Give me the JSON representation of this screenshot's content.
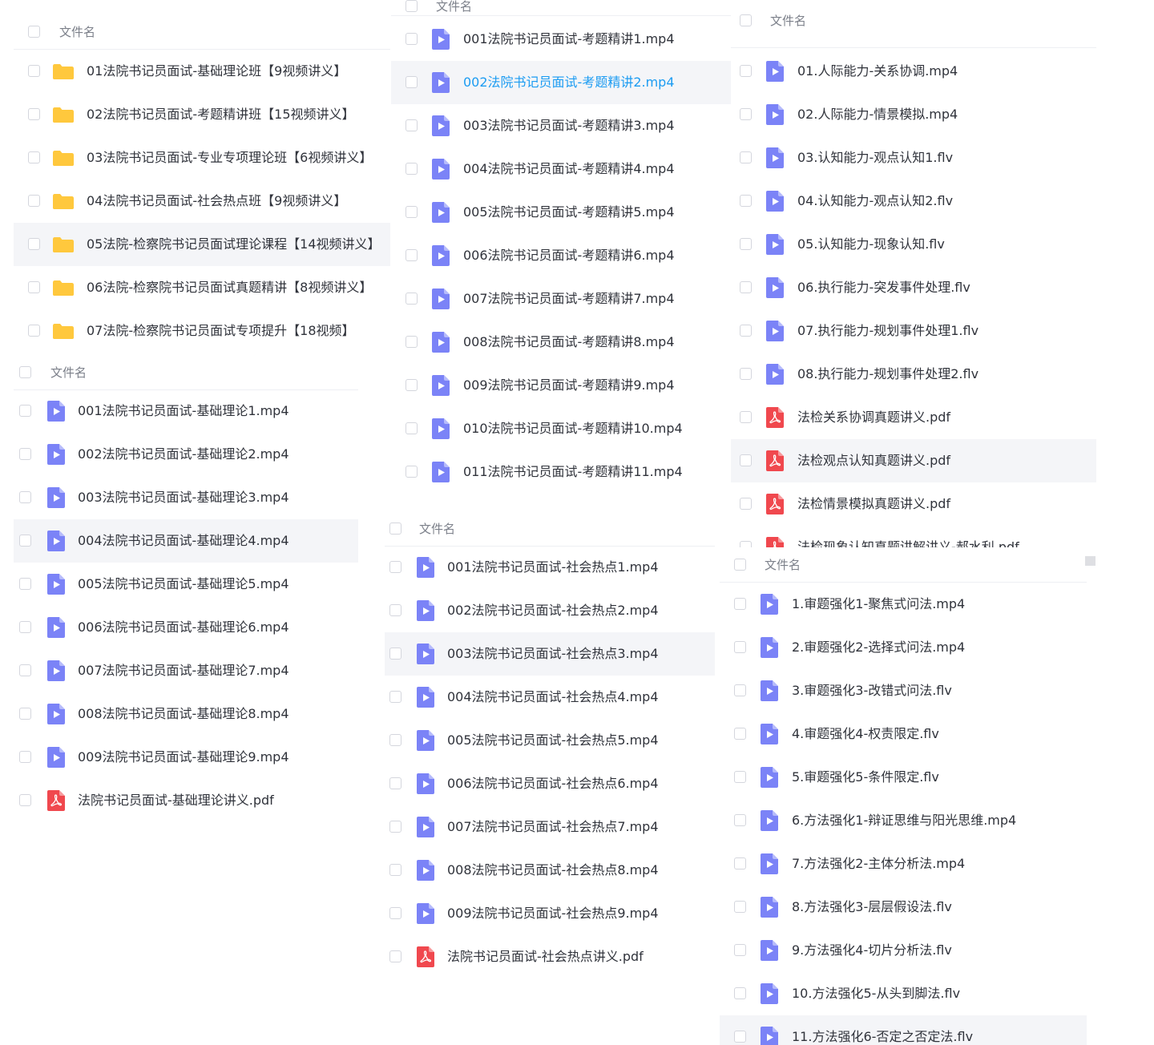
{
  "panels": {
    "a": {
      "header": "文件名",
      "items": [
        {
          "type": "folder",
          "label": "01法院书记员面试-基础理论班【9视频讲义】"
        },
        {
          "type": "folder",
          "label": "02法院书记员面试-考题精讲班【15视频讲义】"
        },
        {
          "type": "folder",
          "label": "03法院书记员面试-专业专项理论班【6视频讲义】"
        },
        {
          "type": "folder",
          "label": "04法院书记员面试-社会热点班【9视频讲义】"
        },
        {
          "type": "folder",
          "label": "05法院-检察院书记员面试理论课程【14视频讲义】",
          "highlight": true
        },
        {
          "type": "folder",
          "label": "06法院-检察院书记员面试真题精讲【8视频讲义】"
        },
        {
          "type": "folder",
          "label": "07法院-检察院书记员面试专项提升【18视频】"
        }
      ]
    },
    "b": {
      "header": "文件名",
      "items": [
        {
          "type": "video",
          "label": "001法院书记员面试-基础理论1.mp4"
        },
        {
          "type": "video",
          "label": "002法院书记员面试-基础理论2.mp4"
        },
        {
          "type": "video",
          "label": "003法院书记员面试-基础理论3.mp4"
        },
        {
          "type": "video",
          "label": "004法院书记员面试-基础理论4.mp4",
          "highlight": true
        },
        {
          "type": "video",
          "label": "005法院书记员面试-基础理论5.mp4"
        },
        {
          "type": "video",
          "label": "006法院书记员面试-基础理论6.mp4"
        },
        {
          "type": "video",
          "label": "007法院书记员面试-基础理论7.mp4"
        },
        {
          "type": "video",
          "label": "008法院书记员面试-基础理论8.mp4"
        },
        {
          "type": "video",
          "label": "009法院书记员面试-基础理论9.mp4"
        },
        {
          "type": "pdf",
          "label": "法院书记员面试-基础理论讲义.pdf"
        }
      ]
    },
    "c": {
      "header": "文件名",
      "items": [
        {
          "type": "video",
          "label": "001法院书记员面试-考题精讲1.mp4"
        },
        {
          "type": "video",
          "label": "002法院书记员面试-考题精讲2.mp4",
          "highlight": true,
          "active": true
        },
        {
          "type": "video",
          "label": "003法院书记员面试-考题精讲3.mp4"
        },
        {
          "type": "video",
          "label": "004法院书记员面试-考题精讲4.mp4"
        },
        {
          "type": "video",
          "label": "005法院书记员面试-考题精讲5.mp4"
        },
        {
          "type": "video",
          "label": "006法院书记员面试-考题精讲6.mp4"
        },
        {
          "type": "video",
          "label": "007法院书记员面试-考题精讲7.mp4"
        },
        {
          "type": "video",
          "label": "008法院书记员面试-考题精讲8.mp4"
        },
        {
          "type": "video",
          "label": "009法院书记员面试-考题精讲9.mp4"
        },
        {
          "type": "video",
          "label": "010法院书记员面试-考题精讲10.mp4"
        },
        {
          "type": "video",
          "label": "011法院书记员面试-考题精讲11.mp4"
        }
      ]
    },
    "d": {
      "header": "文件名",
      "items": [
        {
          "type": "video",
          "label": "001法院书记员面试-社会热点1.mp4"
        },
        {
          "type": "video",
          "label": "002法院书记员面试-社会热点2.mp4"
        },
        {
          "type": "video",
          "label": "003法院书记员面试-社会热点3.mp4",
          "highlight": true
        },
        {
          "type": "video",
          "label": "004法院书记员面试-社会热点4.mp4"
        },
        {
          "type": "video",
          "label": "005法院书记员面试-社会热点5.mp4"
        },
        {
          "type": "video",
          "label": "006法院书记员面试-社会热点6.mp4"
        },
        {
          "type": "video",
          "label": "007法院书记员面试-社会热点7.mp4"
        },
        {
          "type": "video",
          "label": "008法院书记员面试-社会热点8.mp4"
        },
        {
          "type": "video",
          "label": "009法院书记员面试-社会热点9.mp4"
        },
        {
          "type": "pdf",
          "label": "法院书记员面试-社会热点讲义.pdf"
        }
      ]
    },
    "e": {
      "header": "文件名",
      "items": [
        {
          "type": "video",
          "label": "01.人际能力-关系协调.mp4"
        },
        {
          "type": "video",
          "label": "02.人际能力-情景模拟.mp4"
        },
        {
          "type": "video",
          "label": "03.认知能力-观点认知1.flv"
        },
        {
          "type": "video",
          "label": "04.认知能力-观点认知2.flv"
        },
        {
          "type": "video",
          "label": "05.认知能力-现象认知.flv"
        },
        {
          "type": "video",
          "label": "06.执行能力-突发事件处理.flv"
        },
        {
          "type": "video",
          "label": "07.执行能力-规划事件处理1.flv"
        },
        {
          "type": "video",
          "label": "08.执行能力-规划事件处理2.flv"
        },
        {
          "type": "pdf",
          "label": "法检关系协调真题讲义.pdf"
        },
        {
          "type": "pdf",
          "label": "法检观点认知真题讲义.pdf",
          "highlight": true
        },
        {
          "type": "pdf",
          "label": "法检情景模拟真题讲义.pdf"
        },
        {
          "type": "pdf",
          "label": "法检现象认知真题讲解讲义-郝水利.pdf"
        }
      ]
    },
    "f": {
      "header": "文件名",
      "items": [
        {
          "type": "video",
          "label": "1.审题强化1-聚焦式问法.mp4"
        },
        {
          "type": "video",
          "label": "2.审题强化2-选择式问法.mp4"
        },
        {
          "type": "video",
          "label": "3.审题强化3-改错式问法.flv"
        },
        {
          "type": "video",
          "label": "4.审题强化4-权责限定.flv"
        },
        {
          "type": "video",
          "label": "5.审题强化5-条件限定.flv"
        },
        {
          "type": "video",
          "label": "6.方法强化1-辩证思维与阳光思维.mp4"
        },
        {
          "type": "video",
          "label": "7.方法强化2-主体分析法.mp4"
        },
        {
          "type": "video",
          "label": "8.方法强化3-层层假设法.flv"
        },
        {
          "type": "video",
          "label": "9.方法强化4-切片分析法.flv"
        },
        {
          "type": "video",
          "label": "10.方法强化5-从头到脚法.flv"
        },
        {
          "type": "video",
          "label": "11.方法强化6-否定之否定法.flv",
          "highlight": true
        }
      ]
    }
  },
  "icons": {
    "folder": "folder-icon",
    "video": "video-file-icon",
    "pdf": "pdf-file-icon"
  },
  "colors": {
    "folder": "#ffc83d",
    "video": "#7b83f7",
    "pdf": "#f0484e",
    "active_text": "#1c9cf2",
    "highlight_row": "#f4f5f8"
  }
}
